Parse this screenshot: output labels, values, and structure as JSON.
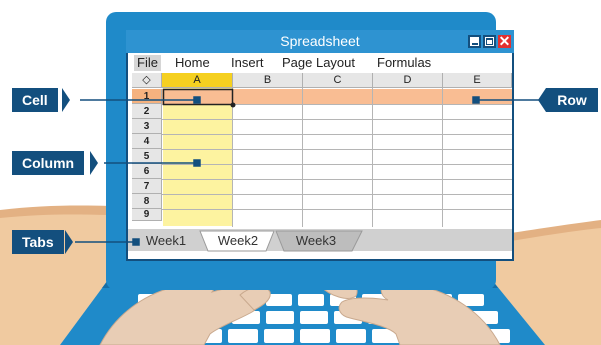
{
  "window": {
    "title": "Spreadsheet",
    "close_glyph": "✕"
  },
  "menu": [
    "File",
    "Home",
    "Insert",
    "Page Layout",
    "Formulas"
  ],
  "columns": [
    "A",
    "B",
    "C",
    "D",
    "E"
  ],
  "corner_glyph": "◇",
  "rows": [
    "1",
    "2",
    "3",
    "4",
    "5",
    "6",
    "7",
    "8",
    "9"
  ],
  "tabs": [
    "Week1",
    "Week2",
    "Week3"
  ],
  "callouts": {
    "cell": "Cell",
    "column": "Column",
    "tabs": "Tabs",
    "row": "Row"
  },
  "colors": {
    "bezel": "#1f8ac9",
    "callout": "#134f7e",
    "selected_column_header": "#f5d020",
    "selected_column_band": "#fdf3a0",
    "selected_row": "#f9bd93",
    "close_button": "#e23030"
  }
}
